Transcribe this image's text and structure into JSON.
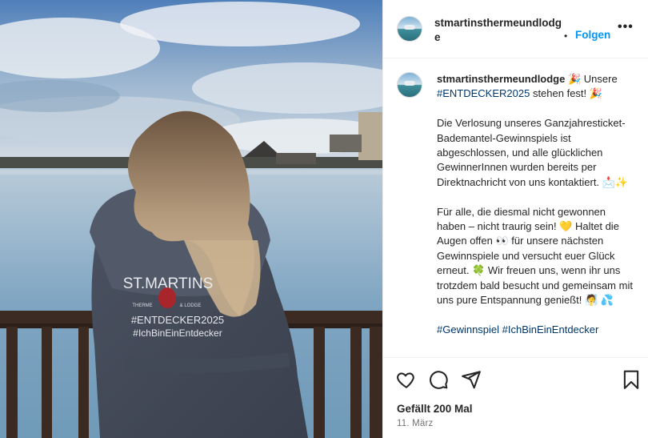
{
  "post": {
    "photo": {
      "robe_brand": "ST.MARTINS",
      "robe_sub_left": "THERME",
      "robe_sub_right": "& LODGE",
      "robe_hashtag_1": "#ENTDECKER2025",
      "robe_hashtag_2": "#IchBinEinEntdecker"
    },
    "header": {
      "username": "stmartinsthermeundlodge",
      "separator": "•",
      "follow_label": "Folgen",
      "more_label": "•••"
    },
    "caption": {
      "username": "stmartinsthermeundlodge",
      "line1_a": " 🎉 Unsere ",
      "hashtag_entdecker": "#ENTDECKER2025",
      "line1_b": " stehen fest! 🎉",
      "para2": "Die Verlosung unseres Ganzjahresticket-Bademantel-Gewinnspiels ist abgeschlossen, und alle glücklichen GewinnerInnen wurden bereits per Direktnachricht von uns kontaktiert. 📩✨",
      "para3": "Für alle, die diesmal nicht gewonnen haben – nicht traurig sein! 💛 Haltet die Augen offen 👀 für unsere nächsten Gewinnspiele und versucht euer Glück erneut. 🍀 Wir freuen uns, wenn ihr uns trotzdem bald besucht und gemeinsam mit uns pure Entspannung genießt! 🧖 💦",
      "hashtags": "#Gewinnspiel #IchBinEinEntdecker"
    },
    "actions": {
      "like_icon": "heart-icon",
      "comment_icon": "speech-bubble-icon",
      "share_icon": "paper-plane-icon",
      "save_icon": "bookmark-icon"
    },
    "likes_text": "Gefällt 200 Mal",
    "date_text": "11. März"
  },
  "colors": {
    "follow": "#0095f6",
    "hashtag": "#00376b",
    "text": "#262626",
    "muted": "#737373"
  }
}
